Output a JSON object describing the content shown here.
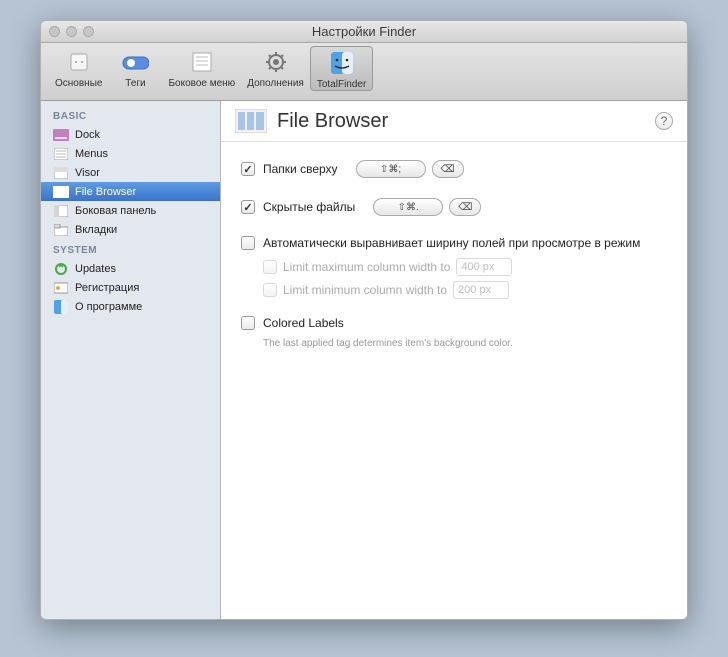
{
  "window": {
    "title": "Настройки Finder"
  },
  "toolbar": {
    "items": [
      {
        "label": "Основные"
      },
      {
        "label": "Теги"
      },
      {
        "label": "Боковое меню"
      },
      {
        "label": "Дополнения"
      },
      {
        "label": "TotalFinder"
      }
    ]
  },
  "sidebar": {
    "section1": "BASIC",
    "basic": [
      {
        "label": "Dock"
      },
      {
        "label": "Menus"
      },
      {
        "label": "Visor"
      },
      {
        "label": "File Browser"
      },
      {
        "label": "Боковая панель"
      },
      {
        "label": "Вкладки"
      }
    ],
    "section2": "SYSTEM",
    "system": [
      {
        "label": "Updates"
      },
      {
        "label": "Регистрация"
      },
      {
        "label": "О программе"
      }
    ]
  },
  "content": {
    "title": "File Browser",
    "help": "?",
    "folders_on_top": "Папки сверху",
    "shortcut1": "⇧⌘;",
    "clear_icon": "⌫",
    "hidden_files": "Скрытые файлы",
    "shortcut2": "⇧⌘.",
    "auto_width": "Автоматически выравнивает ширину полей при просмотре в режим",
    "limit_max": "Limit maximum column width to",
    "max_val": "400 px",
    "limit_min": "Limit minimum column width to",
    "min_val": "200 px",
    "colored_labels": "Colored Labels",
    "colored_hint": "The last applied tag determines item's background color."
  }
}
